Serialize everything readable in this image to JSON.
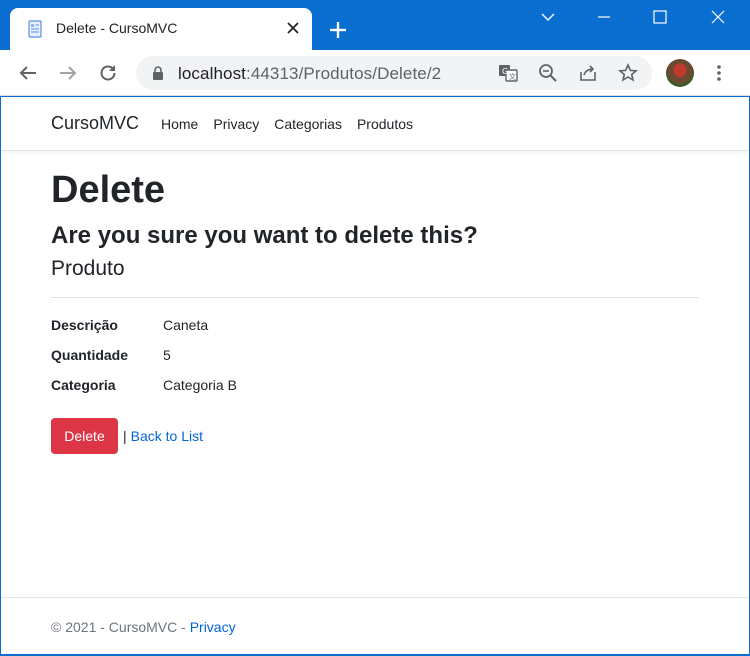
{
  "browser": {
    "tab_title": "Delete - CursoMVC",
    "url_host": "localhost",
    "url_path": ":44313/Produtos/Delete/2"
  },
  "site": {
    "brand": "CursoMVC",
    "nav": [
      "Home",
      "Privacy",
      "Categorias",
      "Produtos"
    ]
  },
  "page": {
    "title": "Delete",
    "confirm": "Are you sure you want to delete this?",
    "entity": "Produto",
    "fields": [
      {
        "label": "Descrição",
        "value": "Caneta"
      },
      {
        "label": "Quantidade",
        "value": "5"
      },
      {
        "label": "Categoria",
        "value": "Categoria B"
      }
    ],
    "delete_label": "Delete",
    "separator": "|",
    "back_label": "Back to List"
  },
  "footer": {
    "text": "© 2021 - CursoMVC - ",
    "privacy": "Privacy"
  },
  "colors": {
    "danger": "#dc3545",
    "link": "#0366d6",
    "chrome": "#0a6ed1"
  }
}
